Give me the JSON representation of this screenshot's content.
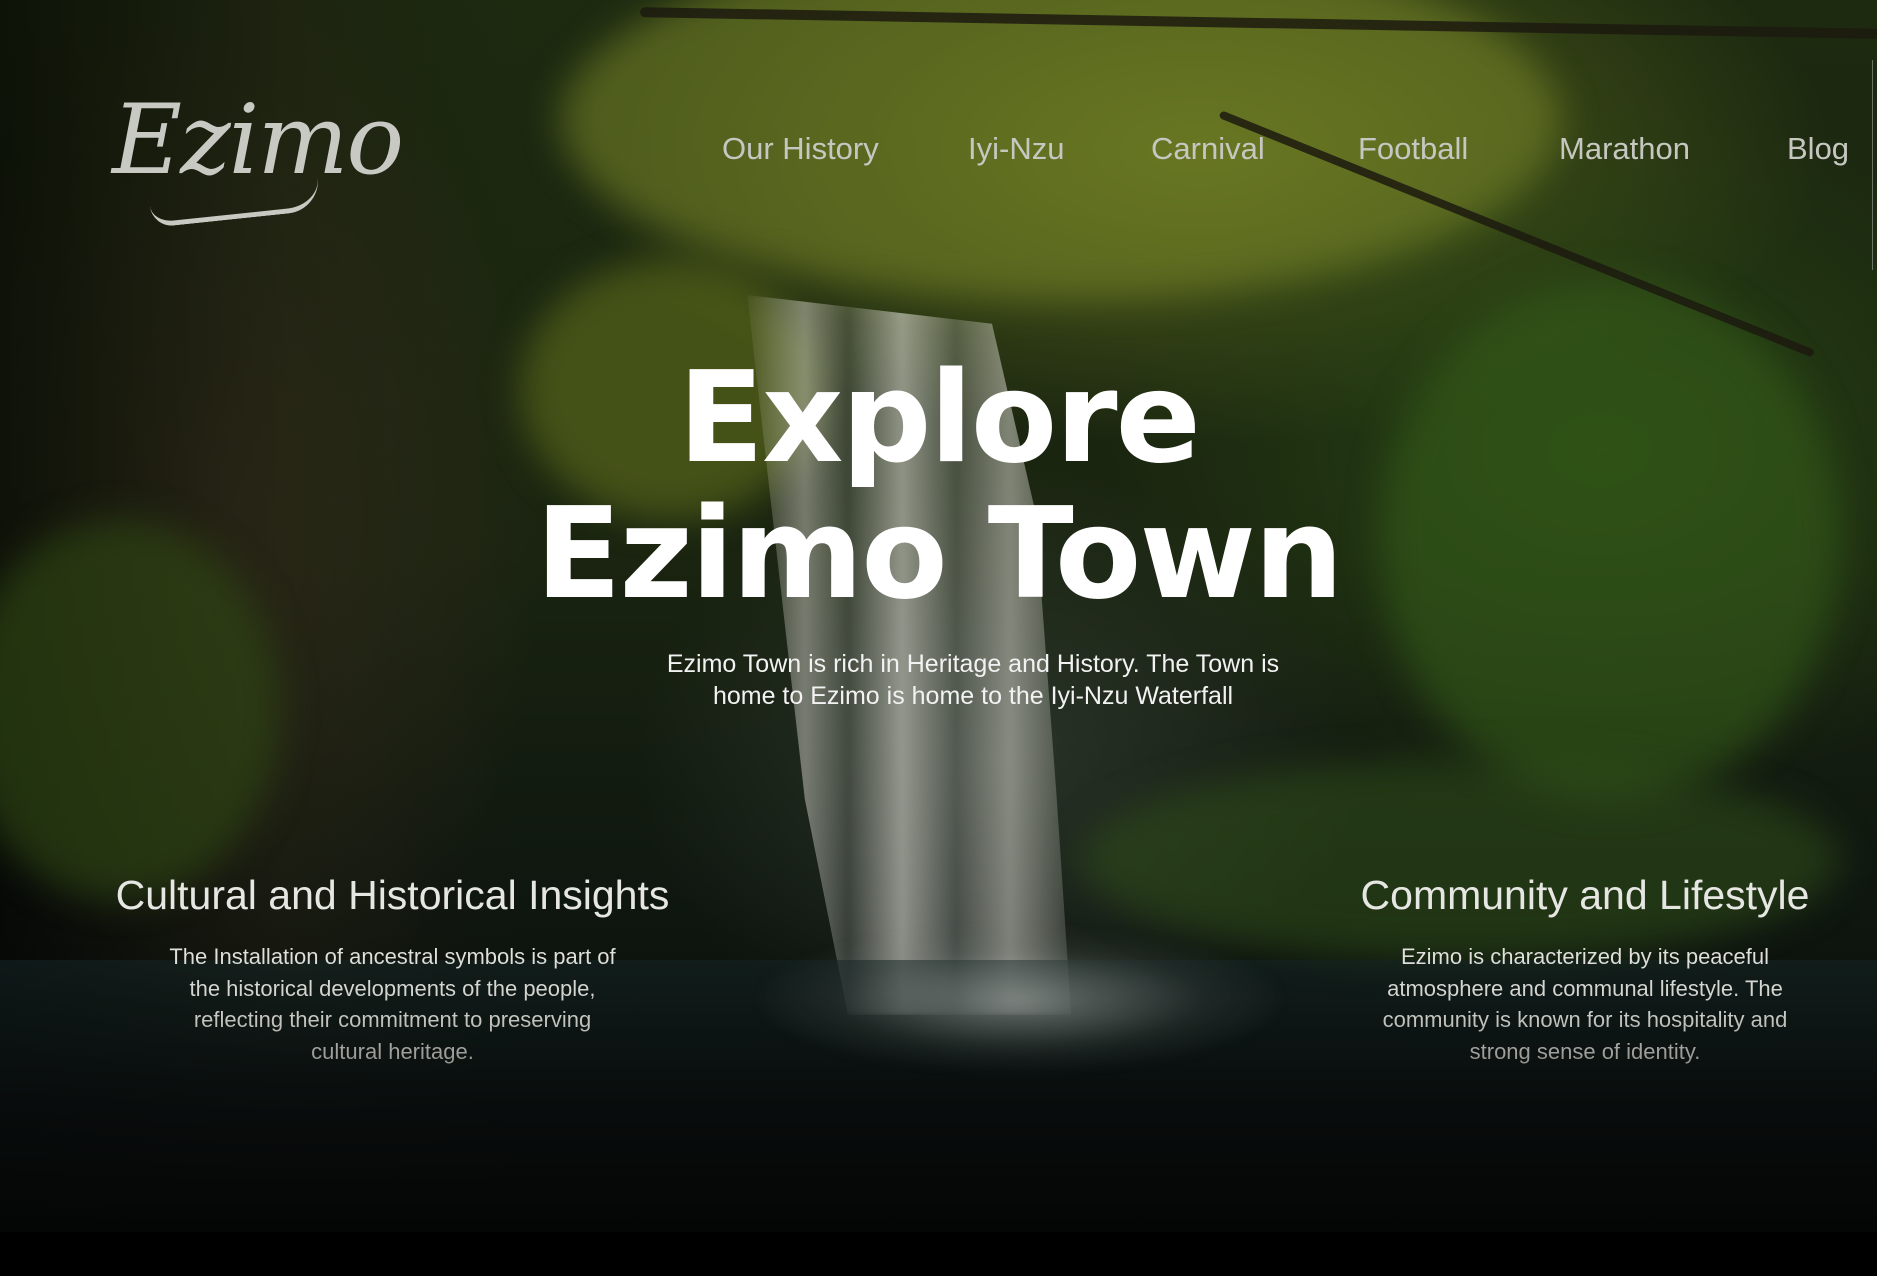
{
  "brand": {
    "logo_text": "Ezimo"
  },
  "nav": {
    "items": [
      {
        "label": "Our History"
      },
      {
        "label": "Iyi-Nzu"
      },
      {
        "label": "Carnival"
      },
      {
        "label": "Football"
      },
      {
        "label": "Marathon"
      },
      {
        "label": "Blog"
      }
    ]
  },
  "hero": {
    "title_line1": "Explore",
    "title_line2": "Ezimo Town",
    "subtitle": "Ezimo Town is rich in Heritage and History. The Town is home to Ezimo is home to the Iyi-Nzu Waterfall"
  },
  "features": {
    "cultural": {
      "heading": "Cultural and Historical Insights",
      "body": "The Installation of ancestral symbols is part of the historical developments of the people, reflecting their commitment to preserving cultural heritage."
    },
    "community": {
      "heading": "Community and Lifestyle",
      "body": "Ezimo is characterized by its peaceful atmosphere and communal lifestyle. The community is known for its hospitality and strong sense of identity."
    }
  },
  "colors": {
    "nav_text": "#c7c7c2",
    "title_text": "#ffffff",
    "background_dark": "#050805",
    "foliage": "#5f6e1e"
  }
}
